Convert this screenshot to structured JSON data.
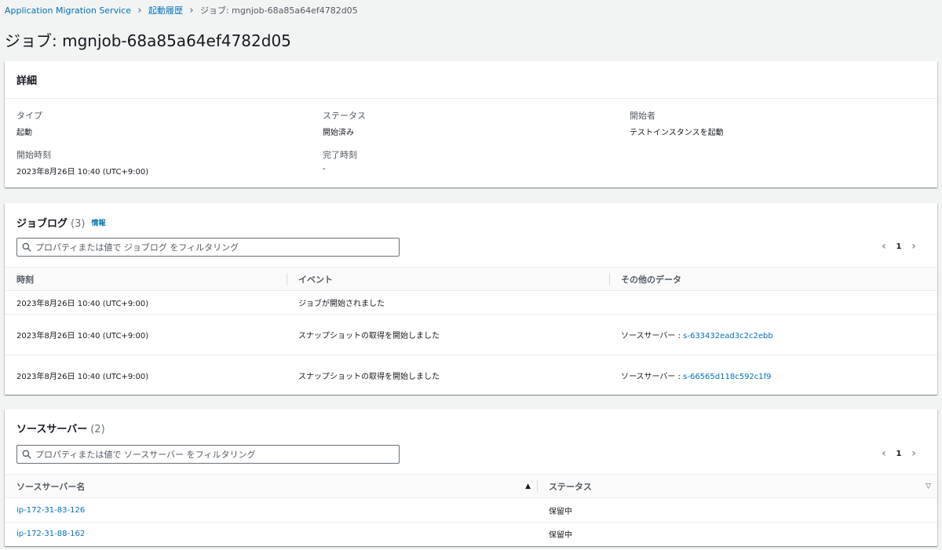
{
  "breadcrumb": {
    "items": [
      "Application Migration Service",
      "起動履歴"
    ],
    "current": "ジョブ: mgnjob-68a85a64ef4782d05"
  },
  "page_title": "ジョブ: mgnjob-68a85a64ef4782d05",
  "details": {
    "heading": "詳細",
    "fields": {
      "type": {
        "label": "タイプ",
        "value": "起動"
      },
      "status": {
        "label": "ステータス",
        "value": "開始済み"
      },
      "initiator": {
        "label": "開始者",
        "value": "テストインスタンスを起動"
      },
      "start_time": {
        "label": "開始時刻",
        "value": "2023年8月26日 10:40 (UTC+9:00)"
      },
      "end_time": {
        "label": "完了時刻",
        "value": "-"
      }
    }
  },
  "job_log": {
    "heading": "ジョブログ",
    "count": "(3)",
    "info_link": "情報",
    "filter_placeholder": "プロパティまたは値で ジョブログ をフィルタリング",
    "page": "1",
    "columns": [
      "時刻",
      "イベント",
      "その他のデータ"
    ],
    "rows": [
      {
        "time": "2023年8月26日 10:40 (UTC+9:00)",
        "event": "ジョブが開始されました",
        "extra_label": "",
        "extra_link": ""
      },
      {
        "time": "2023年8月26日 10:40 (UTC+9:00)",
        "event": "スナップショットの取得を開始しました",
        "extra_label": "ソースサーバー : ",
        "extra_link": "s-633432ead3c2c2ebb"
      },
      {
        "time": "2023年8月26日 10:40 (UTC+9:00)",
        "event": "スナップショットの取得を開始しました",
        "extra_label": "ソースサーバー : ",
        "extra_link": "s-66565d118c592c1f9"
      }
    ]
  },
  "source_servers": {
    "heading": "ソースサーバー",
    "count": "(2)",
    "filter_placeholder": "プロパティまたは値で ソースサーバー をフィルタリング",
    "page": "1",
    "columns": [
      "ソースサーバー名",
      "ステータス"
    ],
    "rows": [
      {
        "name": "ip-172-31-83-126",
        "status": "保留中"
      },
      {
        "name": "ip-172-31-88-162",
        "status": "保留中"
      }
    ]
  }
}
